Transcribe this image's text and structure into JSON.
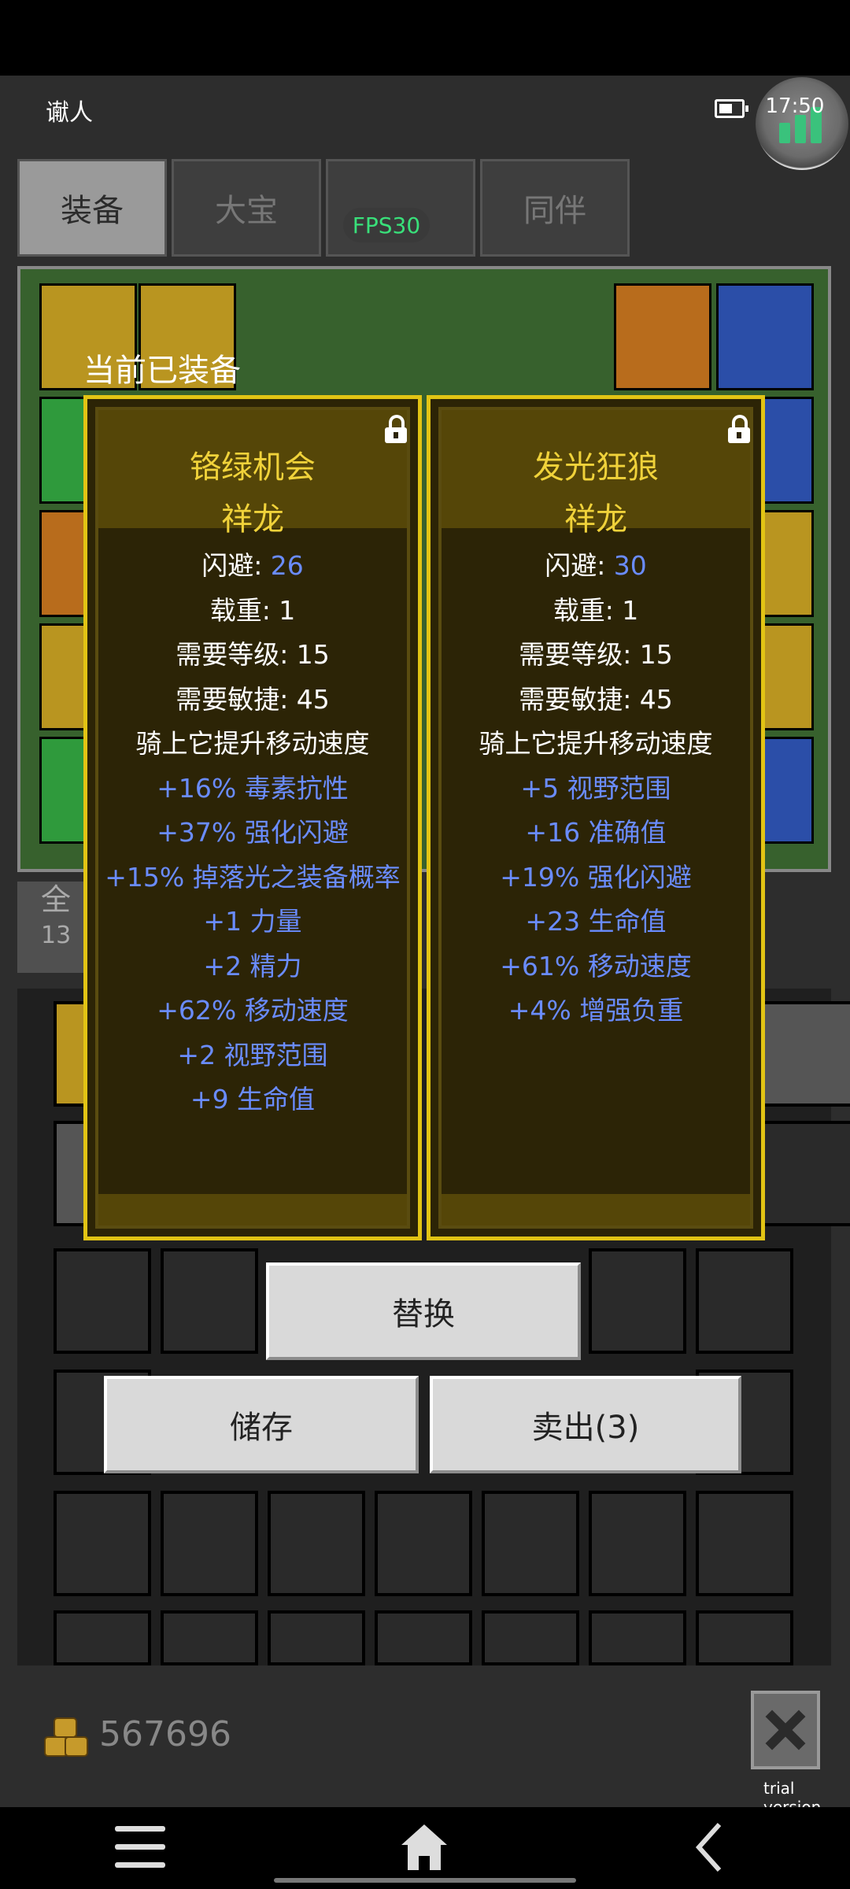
{
  "header": {
    "player_name": "谳人",
    "clock": "17:50"
  },
  "tabs": [
    {
      "label": "装备",
      "active": true
    },
    {
      "label": "大宝",
      "active": false
    },
    {
      "label": "",
      "active": false
    },
    {
      "label": "同伴",
      "active": false
    }
  ],
  "fps": "FPS30",
  "overlay": {
    "current_label": "当前已装备"
  },
  "cards": [
    {
      "name": "铬绿机会",
      "subtitle": "祥龙",
      "dodge_label": "闪避: ",
      "dodge_value": "26",
      "stats": [
        "载重: 1",
        "需要等级: 15",
        "需要敏捷: 45",
        "骑上它提升移动速度"
      ],
      "bonuses": [
        "+16% 毒素抗性",
        "+37% 强化闪避",
        "+15% 掉落光之装备概率",
        "+1 力量",
        "+2 精力",
        "+62% 移动速度",
        "+2 视野范围",
        "+9 生命值"
      ]
    },
    {
      "name": "发光狂狼",
      "subtitle": "祥龙",
      "dodge_label": "闪避: ",
      "dodge_value": "30",
      "stats": [
        "载重: 1",
        "需要等级: 15",
        "需要敏捷: 45",
        "骑上它提升移动速度"
      ],
      "bonuses": [
        "+5 视野范围",
        "+16 准确值",
        "+19% 强化闪避",
        "+23 生命值",
        "+61% 移动速度",
        "+4% 增强负重"
      ]
    }
  ],
  "buttons": {
    "replace": "替换",
    "store": "储存",
    "sell": "卖出(3)"
  },
  "side_tab": {
    "label": "全",
    "count": "13"
  },
  "footer": {
    "gold": "567696",
    "trial": "trial version"
  },
  "colors": {
    "card_border": "#e2c414",
    "title_gold": "#f0d23a",
    "bonus_blue": "#6a8cff",
    "fps_green": "#39e07a"
  }
}
